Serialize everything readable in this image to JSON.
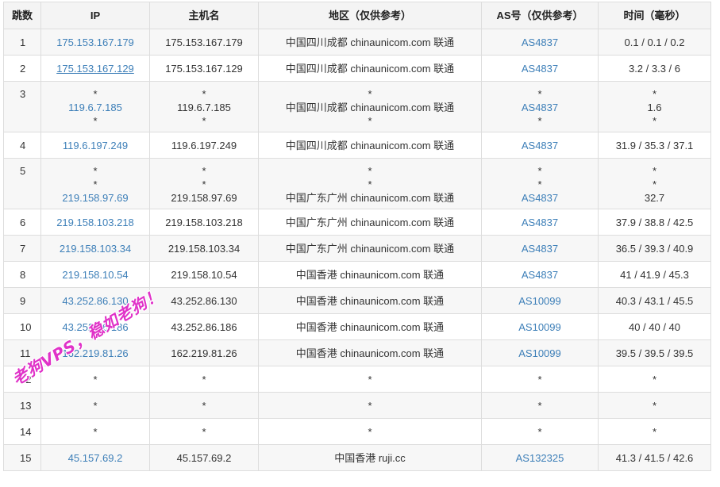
{
  "headers": [
    "跳数",
    "IP",
    "主机名",
    "地区（仅供参考）",
    "AS号（仅供参考）",
    "时间（毫秒）"
  ],
  "rows": [
    {
      "hop": "1",
      "ip": [
        "175.153.167.179"
      ],
      "host": [
        "175.153.167.179"
      ],
      "region": [
        "中国四川成都 chinaunicom.com 联通"
      ],
      "asn": [
        "AS4837"
      ],
      "time": [
        "0.1 / 0.1 / 0.2"
      ]
    },
    {
      "hop": "2",
      "ip": [
        "175.153.167.129"
      ],
      "host": [
        "175.153.167.129"
      ],
      "region": [
        "中国四川成都 chinaunicom.com 联通"
      ],
      "asn": [
        "AS4837"
      ],
      "time": [
        "3.2 / 3.3 / 6"
      ]
    },
    {
      "hop": "3",
      "ip": [
        "*",
        "119.6.7.185",
        "*"
      ],
      "host": [
        "*",
        "119.6.7.185",
        "*"
      ],
      "region": [
        "*",
        "中国四川成都 chinaunicom.com 联通",
        "*"
      ],
      "asn": [
        "*",
        "AS4837",
        "*"
      ],
      "time": [
        "*",
        "1.6",
        "*"
      ]
    },
    {
      "hop": "4",
      "ip": [
        "119.6.197.249"
      ],
      "host": [
        "119.6.197.249"
      ],
      "region": [
        "中国四川成都 chinaunicom.com 联通"
      ],
      "asn": [
        "AS4837"
      ],
      "time": [
        "31.9 / 35.3 / 37.1"
      ]
    },
    {
      "hop": "5",
      "ip": [
        "*",
        "*",
        "219.158.97.69"
      ],
      "host": [
        "*",
        "*",
        "219.158.97.69"
      ],
      "region": [
        "*",
        "*",
        "中国广东广州 chinaunicom.com 联通"
      ],
      "asn": [
        "*",
        "*",
        "AS4837"
      ],
      "time": [
        "*",
        "*",
        "32.7"
      ]
    },
    {
      "hop": "6",
      "ip": [
        "219.158.103.218"
      ],
      "host": [
        "219.158.103.218"
      ],
      "region": [
        "中国广东广州 chinaunicom.com 联通"
      ],
      "asn": [
        "AS4837"
      ],
      "time": [
        "37.9 / 38.8 / 42.5"
      ]
    },
    {
      "hop": "7",
      "ip": [
        "219.158.103.34"
      ],
      "host": [
        "219.158.103.34"
      ],
      "region": [
        "中国广东广州 chinaunicom.com 联通"
      ],
      "asn": [
        "AS4837"
      ],
      "time": [
        "36.5 / 39.3 / 40.9"
      ]
    },
    {
      "hop": "8",
      "ip": [
        "219.158.10.54"
      ],
      "host": [
        "219.158.10.54"
      ],
      "region": [
        "中国香港 chinaunicom.com 联通"
      ],
      "asn": [
        "AS4837"
      ],
      "time": [
        "41 / 41.9 / 45.3"
      ]
    },
    {
      "hop": "9",
      "ip": [
        "43.252.86.130"
      ],
      "host": [
        "43.252.86.130"
      ],
      "region": [
        "中国香港 chinaunicom.com 联通"
      ],
      "asn": [
        "AS10099"
      ],
      "time": [
        "40.3 / 43.1 / 45.5"
      ]
    },
    {
      "hop": "10",
      "ip": [
        "43.252.86.186"
      ],
      "host": [
        "43.252.86.186"
      ],
      "region": [
        "中国香港 chinaunicom.com 联通"
      ],
      "asn": [
        "AS10099"
      ],
      "time": [
        "40 / 40 / 40"
      ]
    },
    {
      "hop": "11",
      "ip": [
        "162.219.81.26"
      ],
      "host": [
        "162.219.81.26"
      ],
      "region": [
        "中国香港 chinaunicom.com 联通"
      ],
      "asn": [
        "AS10099"
      ],
      "time": [
        "39.5 / 39.5 / 39.5"
      ]
    },
    {
      "hop": "12",
      "ip": [
        "*"
      ],
      "host": [
        "*"
      ],
      "region": [
        "*"
      ],
      "asn": [
        "*"
      ],
      "time": [
        "*"
      ]
    },
    {
      "hop": "13",
      "ip": [
        "*"
      ],
      "host": [
        "*"
      ],
      "region": [
        "*"
      ],
      "asn": [
        "*"
      ],
      "time": [
        "*"
      ]
    },
    {
      "hop": "14",
      "ip": [
        "*"
      ],
      "host": [
        "*"
      ],
      "region": [
        "*"
      ],
      "asn": [
        "*"
      ],
      "time": [
        "*"
      ]
    },
    {
      "hop": "15",
      "ip": [
        "45.157.69.2"
      ],
      "host": [
        "45.157.69.2"
      ],
      "region": [
        "中国香港 ruji.cc"
      ],
      "asn": [
        "AS132325"
      ],
      "time": [
        "41.3 / 41.5 / 42.6"
      ]
    }
  ],
  "watermark": "老狗VPS，稳如老狗！",
  "colors": {
    "link": "#3d7fb8",
    "watermark": "#e032c8",
    "stripe": "#f7f7f7",
    "border": "#dddddd"
  }
}
